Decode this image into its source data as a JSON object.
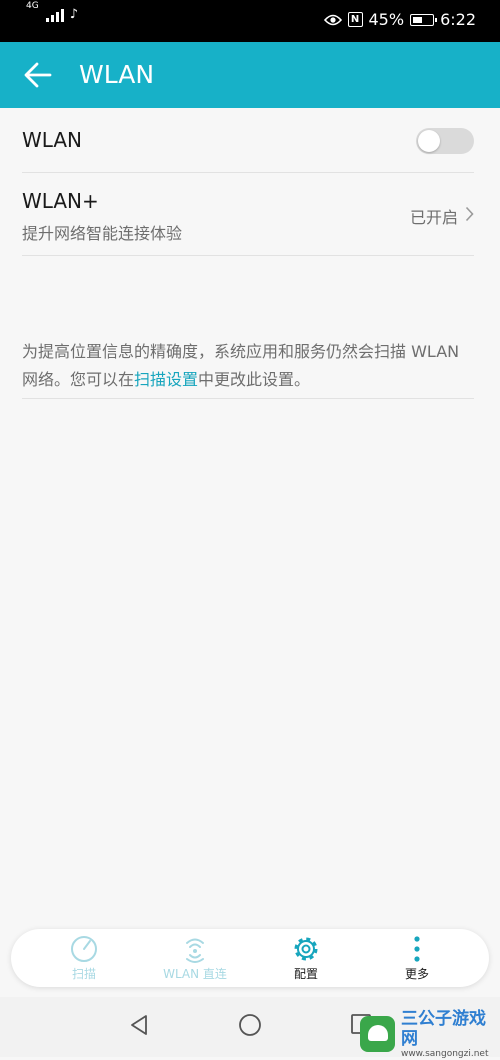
{
  "status_bar": {
    "network_type": "4G",
    "battery_percent": "45%",
    "time": "6:22"
  },
  "app_bar": {
    "title": "WLAN"
  },
  "wlan_toggle": {
    "label": "WLAN",
    "enabled": false
  },
  "wlan_plus": {
    "title": "WLAN+",
    "subtitle": "提升网络智能连接体验",
    "status": "已开启"
  },
  "info": {
    "text_before": "为提高位置信息的精确度，系统应用和服务仍然会扫描 WLAN 网络。您可以在",
    "link": "扫描设置",
    "text_after": "中更改此设置。"
  },
  "bottom_tabs": [
    {
      "label": "扫描",
      "icon": "scan-icon",
      "enabled": false
    },
    {
      "label": "WLAN 直连",
      "icon": "wifi-direct-icon",
      "enabled": false
    },
    {
      "label": "配置",
      "icon": "gear-icon",
      "enabled": true
    },
    {
      "label": "更多",
      "icon": "more-vertical-icon",
      "enabled": true
    }
  ],
  "watermark": {
    "name": "三公子游戏网",
    "url": "www.sangongzi.net"
  },
  "colors": {
    "accent": "#17b1c8",
    "link": "#17a5bd",
    "disabled_tab": "#a8d9e3"
  }
}
